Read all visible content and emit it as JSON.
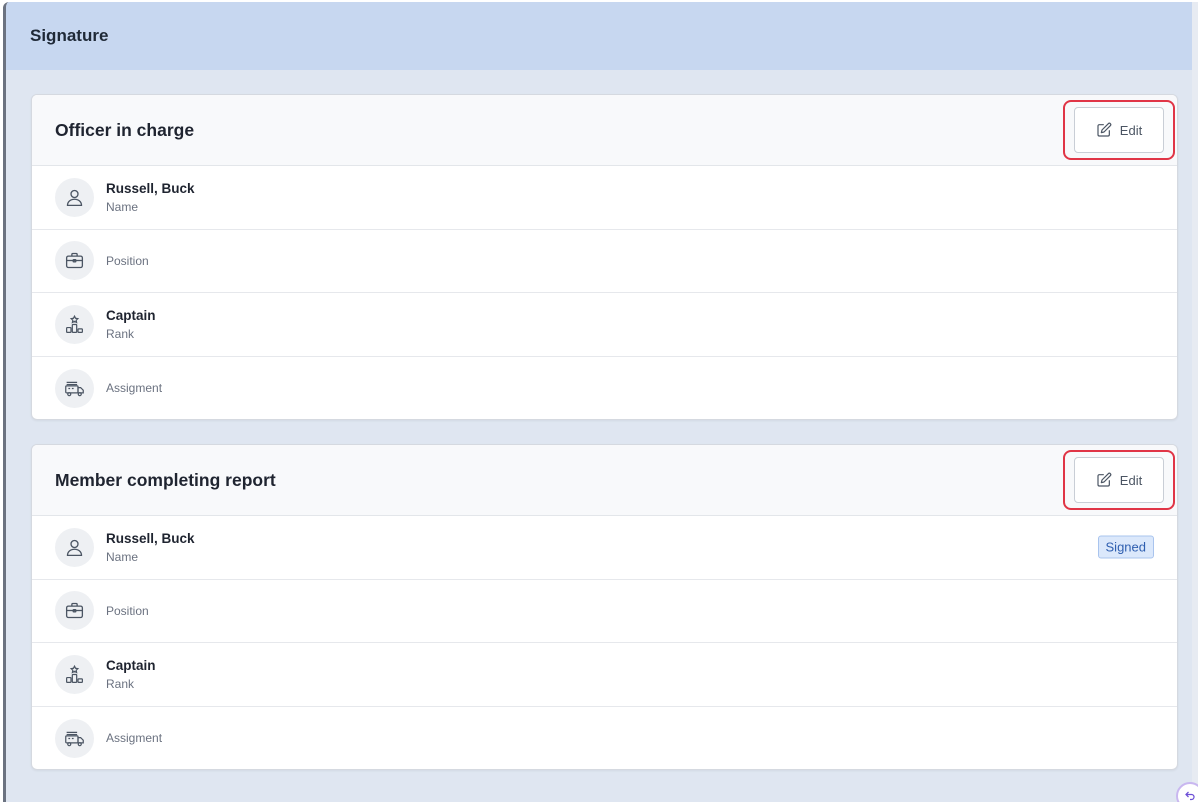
{
  "panel": {
    "title": "Signature"
  },
  "cards": [
    {
      "title": "Officer in charge",
      "edit_label": "Edit",
      "rows": [
        {
          "icon": "user-icon",
          "value": "Russell, Buck",
          "label": "Name"
        },
        {
          "icon": "briefcase-icon",
          "value": "",
          "label": "Position"
        },
        {
          "icon": "podium-star-icon",
          "value": "Captain",
          "label": "Rank"
        },
        {
          "icon": "fire-truck-icon",
          "value": "",
          "label": "Assigment"
        }
      ]
    },
    {
      "title": "Member completing report",
      "edit_label": "Edit",
      "rows": [
        {
          "icon": "user-icon",
          "value": "Russell, Buck",
          "label": "Name",
          "badge": "Signed"
        },
        {
          "icon": "briefcase-icon",
          "value": "",
          "label": "Position"
        },
        {
          "icon": "podium-star-icon",
          "value": "Captain",
          "label": "Rank"
        },
        {
          "icon": "fire-truck-icon",
          "value": "",
          "label": "Assigment"
        }
      ]
    }
  ],
  "colors": {
    "header_bg": "#c7d7f0",
    "panel_bg": "#dfe6f1",
    "highlight": "#e03546",
    "badge_bg": "#dbe8fb",
    "badge_text": "#2f5fb0"
  }
}
